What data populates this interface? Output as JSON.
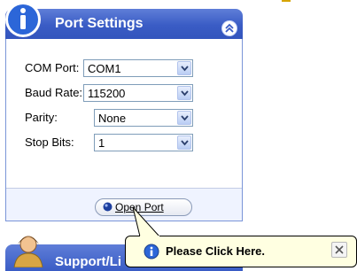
{
  "panel": {
    "title": "Port Settings",
    "fields": [
      {
        "label": "COM Port:",
        "value": "COM1"
      },
      {
        "label": "Baud Rate:",
        "value": "115200"
      },
      {
        "label": "Parity:",
        "value": "None"
      },
      {
        "label": "Stop Bits:",
        "value": "1"
      }
    ],
    "open_port_label": "Open Port"
  },
  "panel2": {
    "title": "Support/Li"
  },
  "tooltip": {
    "text": "Please Click Here."
  },
  "icons": {
    "info": "info-icon",
    "collapse": "chevron-up-double-icon",
    "dropdown": "chevron-down-icon",
    "close": "close-icon",
    "person": "person-icon",
    "connect": "connect-dot-icon"
  },
  "colors": {
    "header_blue": "#3a5cc5",
    "panel_body": "#eff3ff",
    "tooltip_bg": "#ffffe1"
  }
}
